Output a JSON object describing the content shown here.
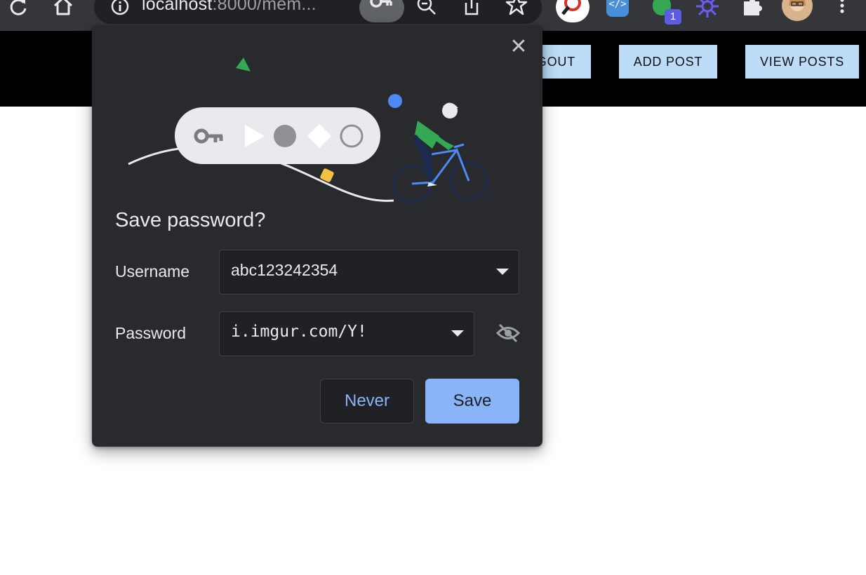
{
  "browser": {
    "url_host": "localhost",
    "url_path": ":8000/mem...",
    "icons": [
      "reload-icon",
      "home-icon",
      "site-info-icon",
      "key-icon",
      "zoom-out-icon",
      "share-icon",
      "star-icon",
      "extension-icon",
      "puzzle-icon",
      "menu-icon"
    ],
    "extension_badge": "1"
  },
  "nav": {
    "logout_label": "GOUT",
    "add_post_label": "ADD POST",
    "view_posts_label": "VIEW POSTS"
  },
  "dialog": {
    "title": "Save password?",
    "username_label": "Username",
    "username_value": "abc123242354",
    "password_label": "Password",
    "password_value": "i.imgur.com/Y!",
    "never_label": "Never",
    "save_label": "Save",
    "close_glyph": "✕"
  },
  "colors": {
    "dialog_bg": "#292a2d",
    "accent": "#8ab4f8",
    "nav_button": "#bcdcf7"
  }
}
